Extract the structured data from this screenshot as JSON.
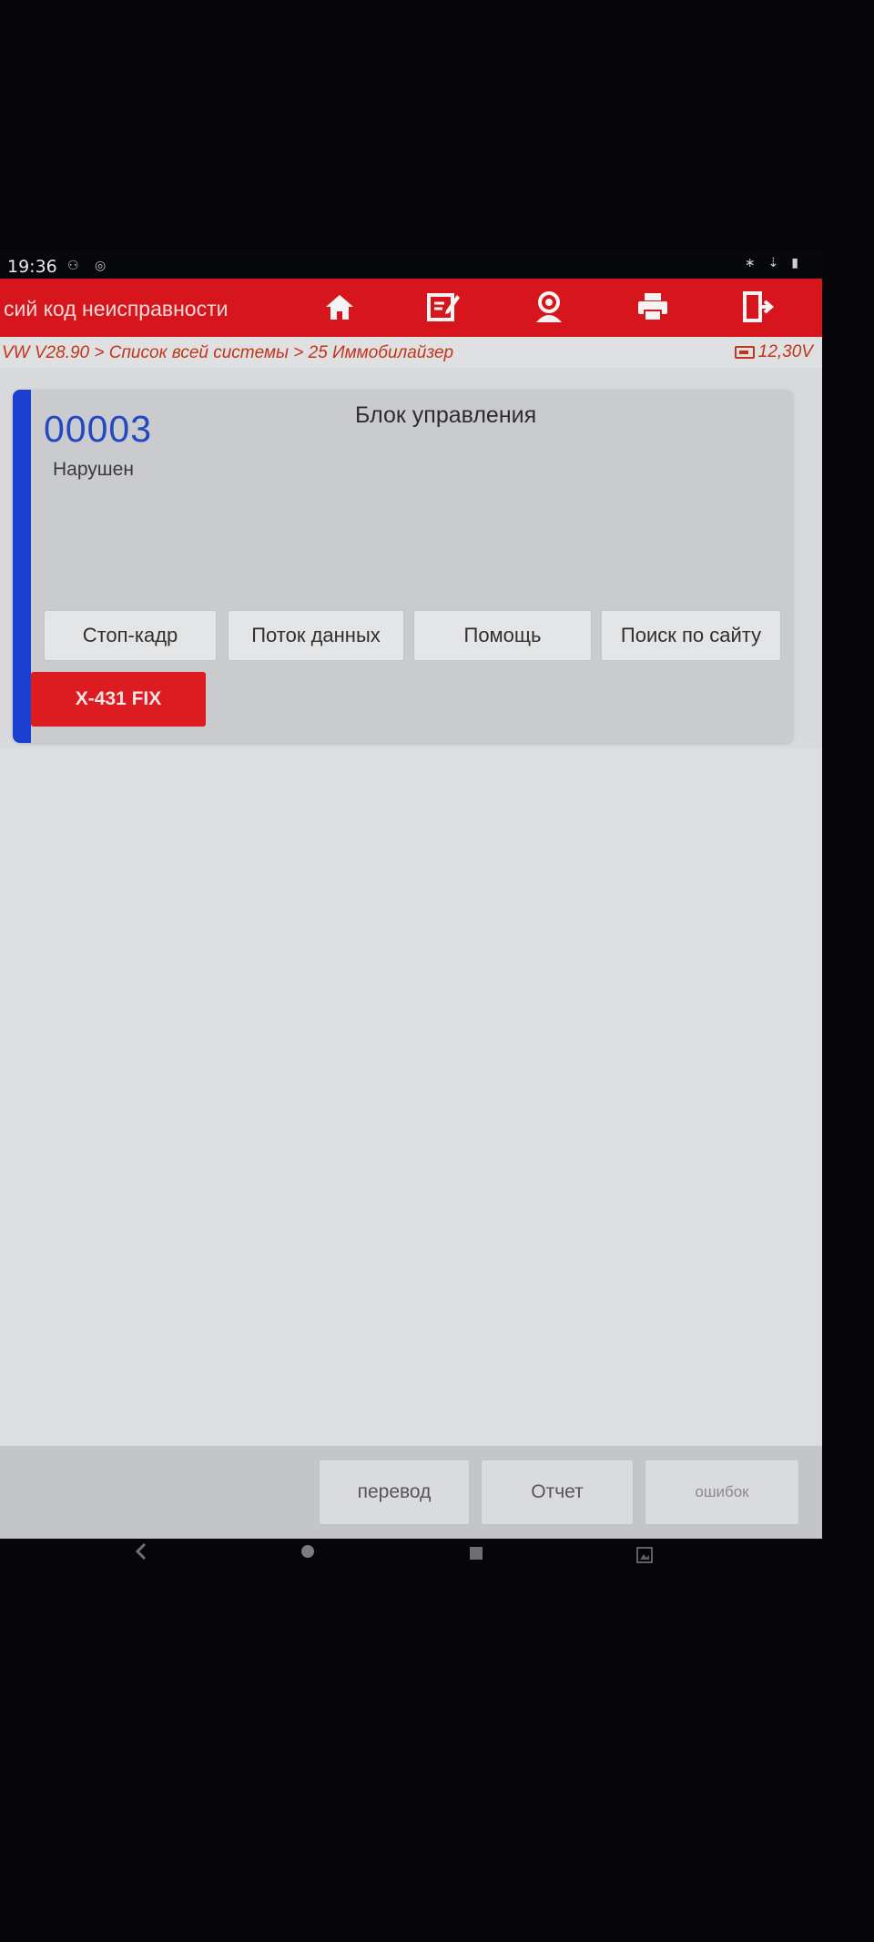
{
  "status_bar": {
    "time": "19:36"
  },
  "title_bar": {
    "title": "сий код неисправности",
    "icons": [
      "home-icon",
      "edit-icon",
      "user-icon",
      "printer-icon",
      "exit-icon"
    ],
    "background_color": "#d6161c"
  },
  "breadcrumb": {
    "path": "VW V28.90 > Список всей системы > 25 Иммобилайзер",
    "voltage": "12,30V"
  },
  "dtc_card": {
    "code": "00003",
    "status": "Нарушен",
    "header": "Блок управления",
    "buttons": [
      "Стоп-кадр",
      "Поток данных",
      "Помощь",
      "Поиск по сайту"
    ],
    "fix_label": "X-431 FIX",
    "accent_color": "#1b3fcf"
  },
  "bottom_bar": {
    "buttons": [
      "перевод",
      "Отчет",
      "ошибок"
    ]
  },
  "nav_bar": {
    "icons": [
      "back-icon",
      "home-circle-icon",
      "recents-icon",
      "screenshot-icon"
    ]
  }
}
